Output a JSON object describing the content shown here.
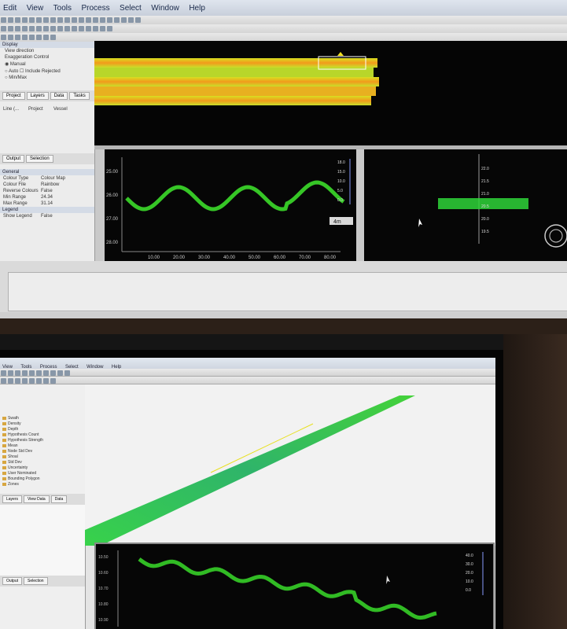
{
  "top": {
    "menu": [
      "Edit",
      "View",
      "Tools",
      "Process",
      "Select",
      "Window",
      "Help"
    ],
    "display": {
      "title": "Display",
      "view_direction_label": "View direction",
      "exaggeration_control": "Exaggeration Control",
      "manual": "Manual",
      "auto": "Auto",
      "include_rejected": "Include Rejected",
      "minmax": "Min/Max"
    },
    "panel_tabs": [
      "Project",
      "Layers",
      "Data",
      "Tasks"
    ],
    "columns": [
      "Line (...",
      "Project",
      "Vessel"
    ],
    "lower_tabs": [
      "Output",
      "Selection"
    ],
    "general": {
      "title": "General",
      "props": [
        {
          "k": "Colour Type",
          "v": "Colour Map"
        },
        {
          "k": "Colour File",
          "v": "Rainbow"
        },
        {
          "k": "Reverse Colours",
          "v": "False"
        },
        {
          "k": "Min Range",
          "v": "24.34"
        },
        {
          "k": "Max Range",
          "v": "31.14"
        }
      ]
    },
    "legend": {
      "title": "Legend",
      "props": [
        {
          "k": "Show Legend",
          "v": "False"
        }
      ]
    },
    "profile": {
      "y_ticks": [
        "25.00",
        "26.00",
        "27.00",
        "28.00"
      ],
      "x_ticks": [
        "10.00",
        "20.00",
        "30.00",
        "40.00",
        "50.00",
        "60.00",
        "70.00",
        "80.00"
      ],
      "scale_ticks": [
        "18.0",
        "15.0",
        "10.0",
        "5.0",
        "0.0"
      ],
      "zoom_value": "4m"
    },
    "cross": {
      "ticks": [
        "22.0",
        "21.5",
        "21.0",
        "20.5",
        "20.0",
        "19.5"
      ]
    }
  },
  "bottom": {
    "menu": [
      "View",
      "Tools",
      "Process",
      "Select",
      "Window",
      "Help"
    ],
    "tree": [
      "Swath",
      "Density",
      "Depth",
      "Hypothesis Count",
      "Hypothesis Strength",
      "Mean",
      "Node Std Dev",
      "Shoal",
      "Std Dev",
      "Uncertainty",
      "User Nominated",
      "Bounding Polygon",
      "Zones"
    ],
    "tabs": [
      "Layers",
      "View Data",
      "Data"
    ],
    "lower_tabs": [
      "Output",
      "Selection"
    ],
    "profile_y_ticks": [
      "10.50",
      "10.60",
      "10.70",
      "10.80",
      "10.90"
    ],
    "profile_scale": [
      "40.0",
      "30.0",
      "20.0",
      "10.0",
      "0.0"
    ]
  }
}
